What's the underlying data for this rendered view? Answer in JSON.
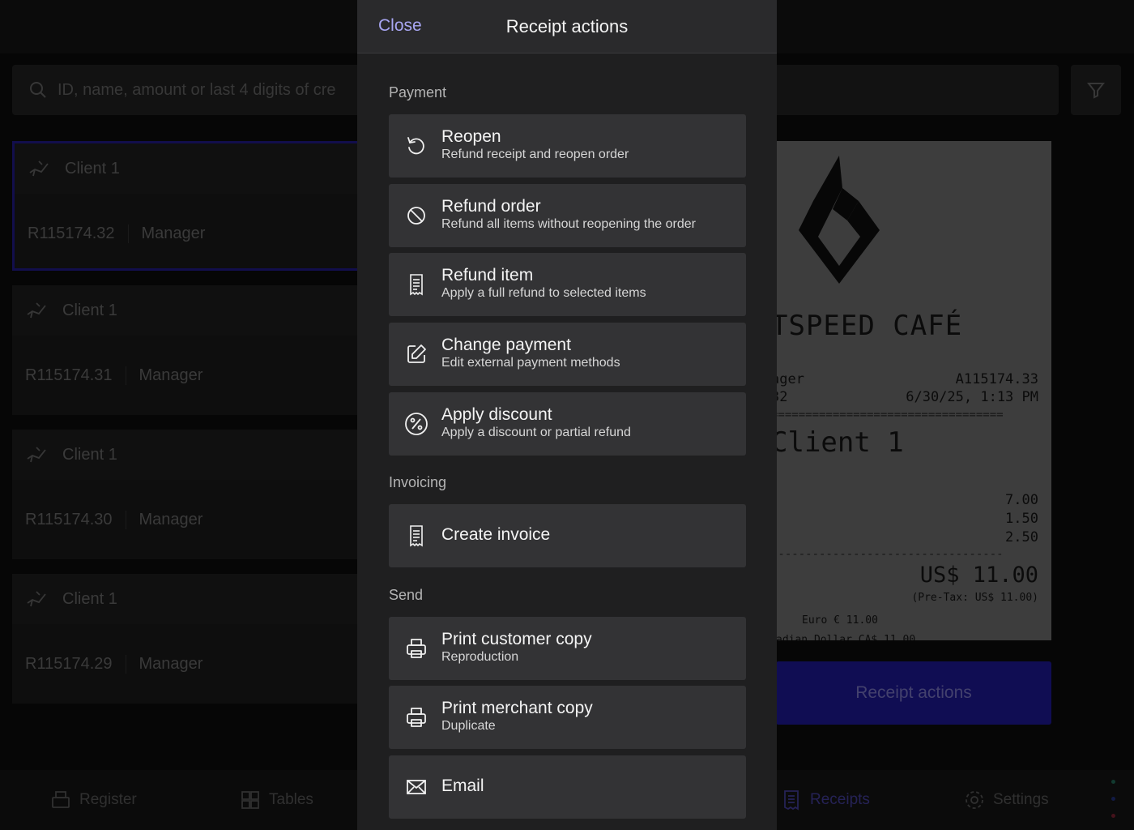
{
  "background": {
    "search": {
      "placeholder": "ID, name, amount or last 4 digits of cre"
    },
    "receipts": [
      {
        "client": "Client 1",
        "id": "R115174.32",
        "user": "Manager",
        "selected": true
      },
      {
        "client": "Client 1",
        "id": "R115174.31",
        "user": "Manager",
        "selected": false
      },
      {
        "client": "Client 1",
        "id": "R115174.30",
        "user": "Manager",
        "selected": false
      },
      {
        "client": "Client 1",
        "id": "R115174.29",
        "user": "Manager",
        "selected": false
      }
    ],
    "receipt_preview": {
      "business_name": "TSPEED CAFÉ",
      "user_fragment": "ager",
      "order_id": "A115174.33",
      "receipt_fragment": "32",
      "datetime": "6/30/25, 1:13 PM",
      "separator_double": "==================================",
      "separator_single": "----------------------------------",
      "client": "Client 1",
      "amounts": [
        "7.00",
        "1.50",
        "2.50"
      ],
      "total": "US$ 11.00",
      "pretax": "(Pre-Tax: US$ 11.00)",
      "euro": "Euro € 11.00",
      "cut_line": "adian Dollar CA$ 11.00"
    },
    "receipt_actions_button": "Receipt actions",
    "nav": {
      "register": "Register",
      "tables": "Tables",
      "receipts": "Receipts",
      "settings": "Settings"
    }
  },
  "modal": {
    "close_label": "Close",
    "title": "Receipt actions",
    "sections": {
      "payment": "Payment",
      "invoicing": "Invoicing",
      "send": "Send"
    },
    "actions": {
      "reopen": {
        "title": "Reopen",
        "subtitle": "Refund receipt and reopen order"
      },
      "refund_order": {
        "title": "Refund order",
        "subtitle": "Refund all items without reopening the order"
      },
      "refund_item": {
        "title": "Refund item",
        "subtitle": "Apply a full refund to selected items"
      },
      "change_payment": {
        "title": "Change payment",
        "subtitle": "Edit external payment methods"
      },
      "apply_discount": {
        "title": "Apply discount",
        "subtitle": "Apply a discount or partial refund"
      },
      "create_invoice": {
        "title": "Create invoice"
      },
      "print_customer": {
        "title": "Print customer copy",
        "subtitle": "Reproduction"
      },
      "print_merchant": {
        "title": "Print merchant copy",
        "subtitle": "Duplicate"
      },
      "email": {
        "title": "Email"
      }
    }
  },
  "colors": {
    "accent": "#a8a6f2",
    "modal_bg": "#1f1f20",
    "action_bg": "#333335",
    "primary_button": "#1a1480"
  },
  "icons": {
    "reopen": "refresh-icon",
    "refund_order": "no-entry-icon",
    "refund_item": "receipt-icon",
    "change_payment": "edit-icon",
    "apply_discount": "percent-icon",
    "create_invoice": "receipt-icon",
    "print": "printer-icon",
    "email": "envelope-icon"
  }
}
